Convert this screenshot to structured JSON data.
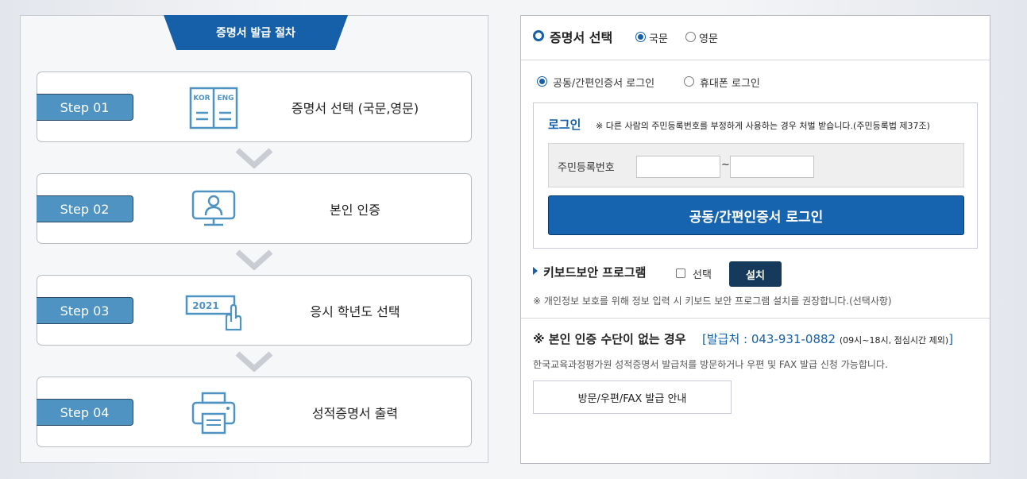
{
  "process": {
    "title": "증명서 발급 절차",
    "steps": [
      {
        "badge": "Step 01",
        "text": "증명서 선택 (국문,영문)",
        "icon": "book-kor-eng-icon",
        "icon_kor": "KOR",
        "icon_eng": "ENG"
      },
      {
        "badge": "Step 02",
        "text": "본인 인증",
        "icon": "monitor-user-icon"
      },
      {
        "badge": "Step 03",
        "text": "응시 학년도 선택",
        "icon": "year-select-hand-icon",
        "icon_year": "2021"
      },
      {
        "badge": "Step 04",
        "text": "성적증명서 출력",
        "icon": "printer-icon"
      }
    ]
  },
  "certificate": {
    "title": "증명서 선택",
    "options": [
      {
        "label": "국문",
        "selected": true
      },
      {
        "label": "영문",
        "selected": false
      }
    ]
  },
  "login_method": {
    "options": [
      {
        "label": "공동/간편인증서 로그인",
        "selected": true
      },
      {
        "label": "휴대폰 로그인",
        "selected": false
      }
    ]
  },
  "login": {
    "title": "로그인",
    "warning": "※ 다른 사람의 주민등록번호를 부정하게 사용하는 경우 처벌 받습니다.(주민등록법 제37조)",
    "id_label": "주민등록번호",
    "id_first_value": "",
    "id_second_value": "",
    "separator": "~",
    "submit_label": "공동/간편인증서 로그인"
  },
  "keyboard_security": {
    "title": "키보드보안 프로그램",
    "checkbox_label": "선택",
    "checked": false,
    "install_label": "설치",
    "note": "※ 개인정보 보호를 위해 정보 입력 시 키보드 보안 프로그램 설치를 권장합니다.(선택사항)"
  },
  "no_auth": {
    "title": "※ 본인 인증 수단이 없는 경우",
    "contact_prefix": "[발급처 : 043-931-0882",
    "contact_hours": "(09시~18시, 점심시간 제외)",
    "contact_suffix": "]",
    "description": "한국교육과정평가원 성적증명서 발급처를 방문하거나 우편 및 FAX 발급 신청 가능합니다.",
    "guide_button": "방문/우편/FAX 발급 안내"
  },
  "colors": {
    "primary": "#1560a8",
    "step_badge": "#4f93c3",
    "install_button": "#163a5c",
    "icon_stroke": "#4f93c3"
  }
}
